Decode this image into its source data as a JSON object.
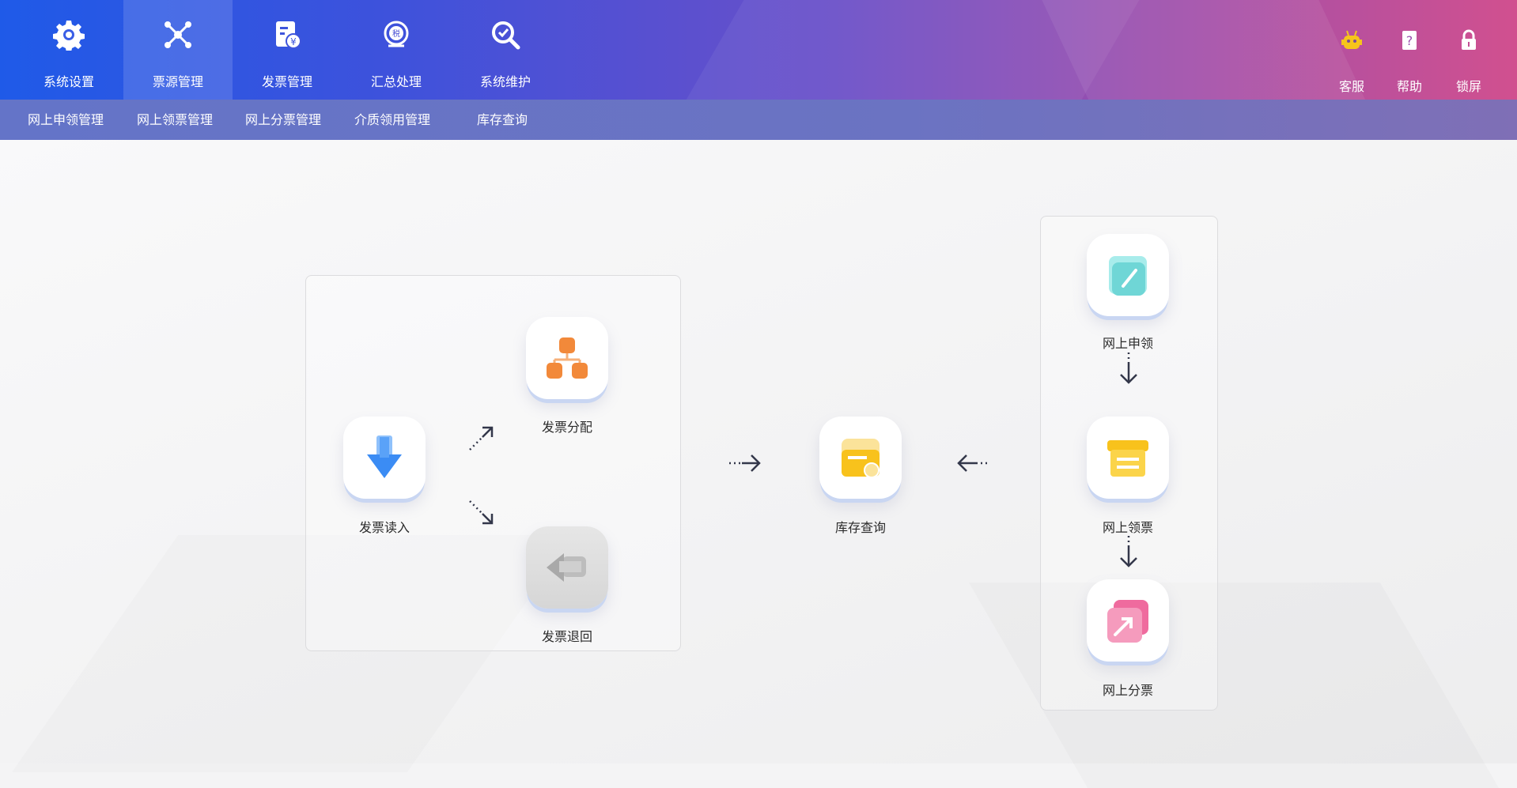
{
  "top_nav": [
    {
      "label": "系统设置",
      "icon": "gear-icon"
    },
    {
      "label": "票源管理",
      "icon": "network-icon"
    },
    {
      "label": "发票管理",
      "icon": "invoice-icon"
    },
    {
      "label": "汇总处理",
      "icon": "tax-summary-icon"
    },
    {
      "label": "系统维护",
      "icon": "maintenance-icon"
    }
  ],
  "top_nav_active": "票源管理",
  "utilities": [
    {
      "label": "客服",
      "icon": "robot-icon"
    },
    {
      "label": "帮助",
      "icon": "help-book-icon"
    },
    {
      "label": "锁屏",
      "icon": "lock-icon"
    }
  ],
  "sub_nav": [
    "网上申领管理",
    "网上领票管理",
    "网上分票管理",
    "介质领用管理",
    "库存查询"
  ],
  "flow": {
    "read_in": "发票读入",
    "distribute": "发票分配",
    "return": "发票退回",
    "inventory": "库存查询",
    "apply_online": "网上申领",
    "receive_online": "网上领票",
    "split_online": "网上分票"
  },
  "colors": {
    "accent_blue": "#1f5ae8",
    "accent_pink": "#d1508f",
    "icon_orange": "#f2893a",
    "icon_yellow": "#f8c21c",
    "icon_cyan": "#6fd6d6",
    "icon_pink": "#ef6b9e",
    "icon_blue": "#3b8cf4"
  }
}
